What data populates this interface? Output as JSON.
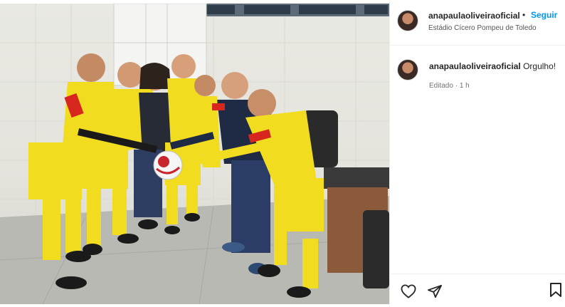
{
  "post": {
    "username": "anapaulaoliveiraoficial",
    "separator": "•",
    "follow_label": "Seguir",
    "location": "Estádio Cícero Pompeu de Toledo",
    "caption_username": "anapaulaoliveiraoficial",
    "caption_text": "Orgulho!",
    "edited_label": "Editado",
    "edited_dot": "·",
    "edited_time": "1 h"
  },
  "icons": {
    "like": "heart-icon",
    "share": "share-icon",
    "save": "bookmark-icon"
  },
  "colors": {
    "follow": "#0095f6",
    "kit_yellow": "#f2dc1f",
    "kit_black": "#1a1a1a",
    "kit_red": "#d6261e"
  }
}
